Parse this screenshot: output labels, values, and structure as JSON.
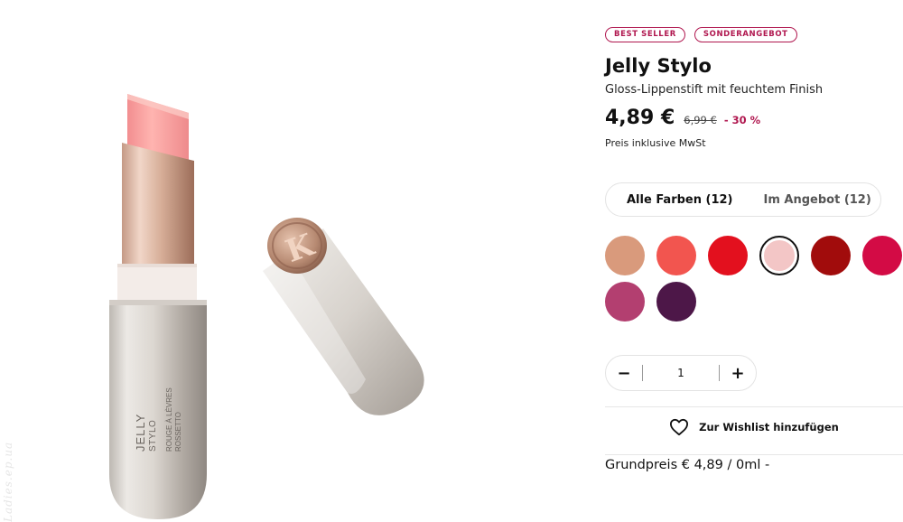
{
  "product": {
    "badges": [
      "BEST SELLER",
      "SONDERANGEBOT"
    ],
    "title": "Jelly Stylo",
    "subtitle": "Gloss-Lippenstift mit feuchtem Finish",
    "price": "4,89 €",
    "old_price": "6,99 €",
    "discount": "- 30 %",
    "vat_note": "Preis inklusive MwSt",
    "image": {
      "tube_lines": [
        "JELLY",
        "STYLO"
      ],
      "tube_small_lines": [
        "ROUGE À LÈVRES",
        "ROSSETTO"
      ],
      "cap_logo": "K"
    },
    "watermark": "Ladies.ep.ua"
  },
  "color_tabs": {
    "all": "Alle Farben (12)",
    "sale": "Im Angebot (12)"
  },
  "swatches": [
    {
      "color": "#d99a7c",
      "selected": false
    },
    {
      "color": "#f2554f",
      "selected": false
    },
    {
      "color": "#e3101e",
      "selected": false
    },
    {
      "color": "#f3c6c6",
      "selected": true
    },
    {
      "color": "#a10c0c",
      "selected": false
    },
    {
      "color": "#d30b45",
      "selected": false
    },
    {
      "color": "#b33f70",
      "selected": false
    },
    {
      "color": "#4d1748",
      "selected": false
    }
  ],
  "quantity": {
    "minus": "−",
    "value": "1",
    "plus": "+"
  },
  "wishlist": {
    "icon": "heart-icon",
    "label": "Zur Wishlist hinzufügen"
  },
  "base_price": "Grundpreis € 4,89 / 0ml -",
  "colors": {
    "accent": "#b0174f",
    "border": "#e3e3e3"
  }
}
